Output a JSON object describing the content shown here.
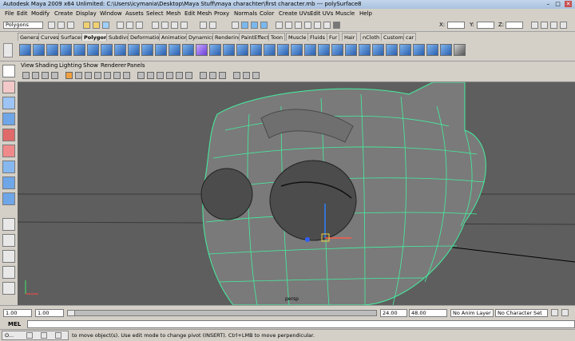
{
  "window": {
    "title": "Autodesk Maya 2009 x64 Unlimited: C:\\Users\\icymania\\Desktop\\Maya Stuff\\maya charachter\\first character.mb   ---   polySurface8",
    "minimize_glyph": "–",
    "maximize_glyph": "□",
    "close_glyph": "✕"
  },
  "menubar": {
    "items": [
      "File",
      "Edit",
      "Modify",
      "Create",
      "Display",
      "Window",
      "Assets",
      "Select",
      "Mesh",
      "Edit Mesh",
      "Proxy",
      "Normals",
      "Color",
      "Create UVs",
      "Edit UVs",
      "Muscle",
      "Help"
    ]
  },
  "statusline": {
    "mode_value": "Polygons",
    "x_label": "X:",
    "y_label": "Y:",
    "z_label": "Z:"
  },
  "shelf": {
    "tabs": [
      "General",
      "Curves",
      "Surfaces",
      "Polygons",
      "Subdivs",
      "Deformation",
      "Animation",
      "Dynamics",
      "Rendering",
      "PaintEffects",
      "Toon",
      "Muscle",
      "Fluids",
      "Fur",
      "Hair",
      "nCloth",
      "Custom",
      "car"
    ],
    "active_tab": "Polygons"
  },
  "panel": {
    "menus": [
      "View",
      "Shading",
      "Lighting",
      "Show",
      "Renderer",
      "Panels"
    ],
    "camera_label": "persp"
  },
  "timeslider": {
    "range_start": "1.00",
    "anim_start": "1.00",
    "current_frame": "1",
    "anim_end": "24.00",
    "range_end": "48.00",
    "anim_layer": "No Anim Layer",
    "character_set": "No Character Set"
  },
  "cmdline": {
    "label": "MEL"
  },
  "helpline": {
    "text": "to move object(s). Use edit mode to change pivot (INSERT). Ctrl+LMB to move perpendicular.",
    "taskbar_label": "O..."
  },
  "colors": {
    "viewport_bg": "#5e5e5e",
    "wireframe": "#43f0a0",
    "ui_gray": "#d4d0c8"
  }
}
